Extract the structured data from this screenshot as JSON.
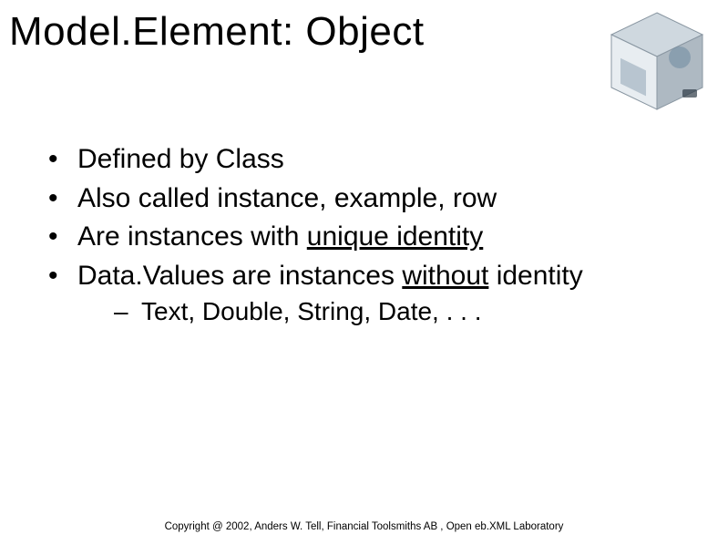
{
  "title": "Model.Element: Object",
  "bullets": {
    "b1": "Defined by Class",
    "b2": "Also called instance, example, row",
    "b3_pre": "Are instances with ",
    "b3_u": "unique identity",
    "b4_pre": "Data.Values are instances ",
    "b4_u": "without",
    "b4_post": " identity",
    "s1": "Text, Double, String, Date, . . ."
  },
  "footer": "Copyright @ 2002, Anders W. Tell, Financial Toolsmiths AB , Open eb.XML Laboratory"
}
